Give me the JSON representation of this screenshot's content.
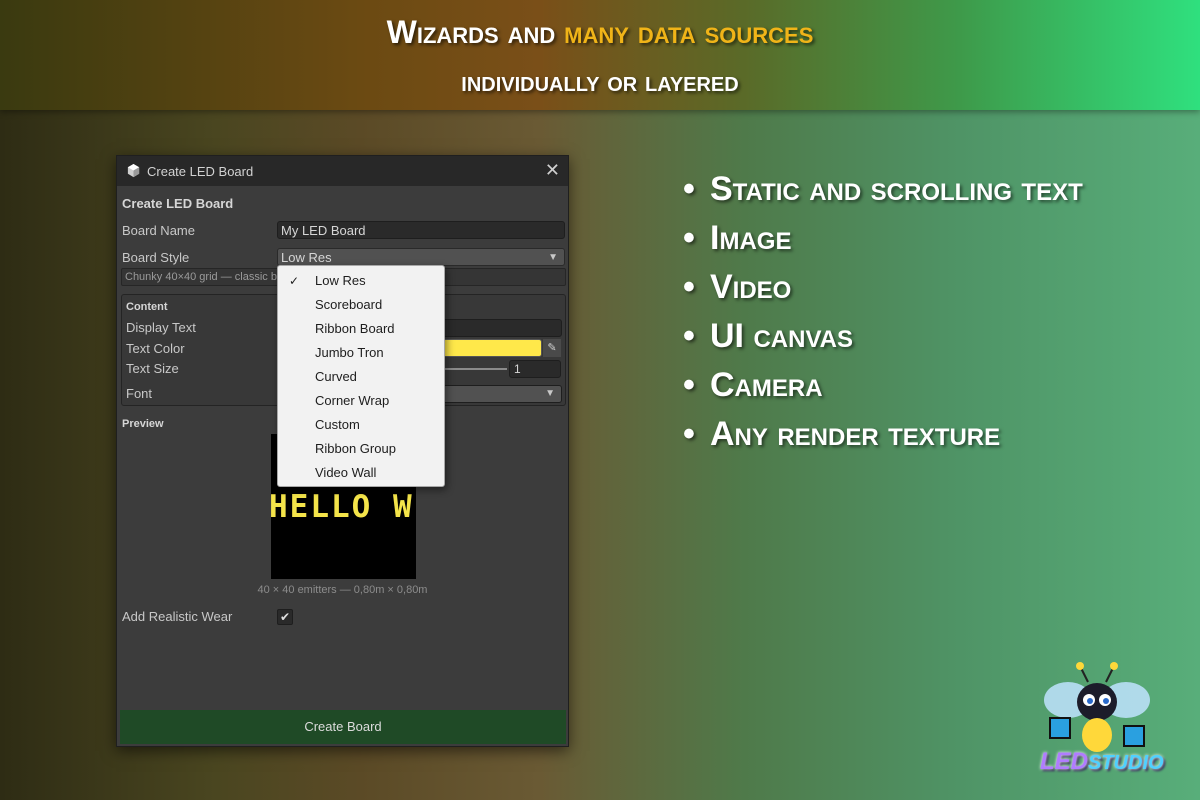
{
  "banner": {
    "line1_part1": "Wizards and ",
    "line1_highlight": "many data sources",
    "line2": "individually or layered"
  },
  "window": {
    "title": "Create LED Board",
    "close": "✕",
    "section_title": "Create LED Board",
    "board_name_label": "Board Name",
    "board_name_value": "My LED Board",
    "board_style_label": "Board Style",
    "board_style_value": "Low Res",
    "style_description": "Chunky 40×40 grid — classic b",
    "content": {
      "title": "Content",
      "display_text_label": "Display Text",
      "text_color_label": "Text Color",
      "text_color": "#ffe84a",
      "text_size_label": "Text Size",
      "text_size_value": "1",
      "font_label": "Font"
    },
    "preview_title": "Preview",
    "preview_text": "HELLO W",
    "preview_caption": "40 × 40 emitters  —  0,80m × 0,80m",
    "wear_label": "Add Realistic Wear",
    "wear_checked": true,
    "create_button": "Create Board"
  },
  "dropdown": {
    "selected": "Low Res",
    "items": [
      "Low Res",
      "Scoreboard",
      "Ribbon Board",
      "Jumbo Tron",
      "Curved",
      "Corner Wrap",
      "Custom",
      "Ribbon Group",
      "Video Wall"
    ]
  },
  "features": [
    "Static and scrolling text",
    "Image",
    "Video",
    "UI canvas",
    "Camera",
    "Any render texture"
  ],
  "logo": {
    "led": "LED",
    "studio": "STUDIO"
  },
  "colors": {
    "accent": "#f0b418",
    "button": "#1f4a26"
  }
}
